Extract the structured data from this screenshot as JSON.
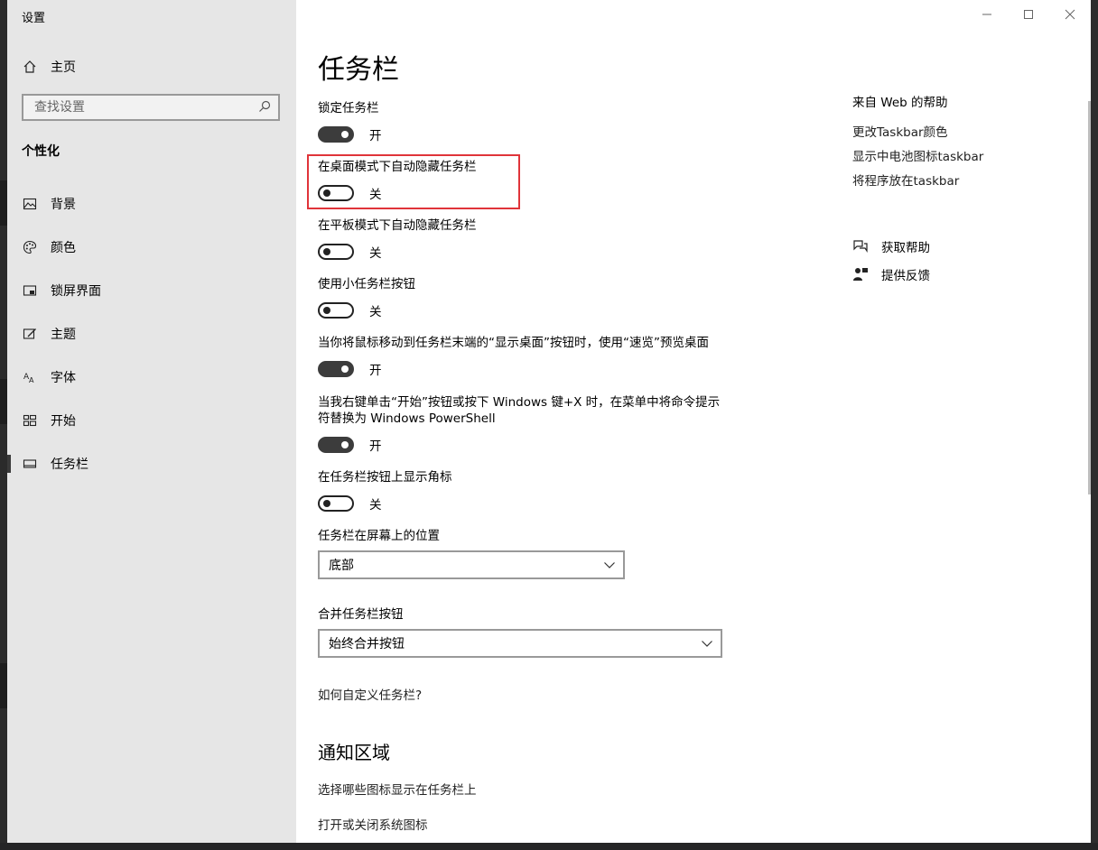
{
  "app": {
    "title": "设置"
  },
  "sidebar": {
    "home_label": "主页",
    "search_placeholder": "查找设置",
    "section_label": "个性化",
    "items": [
      {
        "label": "背景",
        "icon": "image-icon"
      },
      {
        "label": "颜色",
        "icon": "palette-icon"
      },
      {
        "label": "锁屏界面",
        "icon": "lock-screen-icon"
      },
      {
        "label": "主题",
        "icon": "theme-icon"
      },
      {
        "label": "字体",
        "icon": "font-icon"
      },
      {
        "label": "开始",
        "icon": "start-icon"
      },
      {
        "label": "任务栏",
        "icon": "taskbar-icon",
        "active": true
      }
    ]
  },
  "main": {
    "title": "任务栏",
    "settings": [
      {
        "label": "锁定任务栏",
        "state": "on",
        "state_label": "开"
      },
      {
        "label": "在桌面模式下自动隐藏任务栏",
        "state": "off",
        "state_label": "关",
        "highlighted": true
      },
      {
        "label": "在平板模式下自动隐藏任务栏",
        "state": "off",
        "state_label": "关"
      },
      {
        "label": "使用小任务栏按钮",
        "state": "off",
        "state_label": "关"
      },
      {
        "label": "当你将鼠标移动到任务栏末端的“显示桌面”按钮时，使用“速览”预览桌面",
        "state": "on",
        "state_label": "开"
      },
      {
        "label": "当我右键单击“开始”按钮或按下 Windows 键+X 时，在菜单中将命令提示符替换为 Windows PowerShell",
        "state": "on",
        "state_label": "开"
      },
      {
        "label": "在任务栏按钮上显示角标",
        "state": "off",
        "state_label": "关"
      }
    ],
    "position": {
      "label": "任务栏在屏幕上的位置",
      "value": "底部"
    },
    "combine": {
      "label": "合并任务栏按钮",
      "value": "始终合并按钮"
    },
    "customize_link": "如何自定义任务栏?",
    "notification": {
      "title": "通知区域",
      "link1": "选择哪些图标显示在任务栏上",
      "link2": "打开或关闭系统图标"
    }
  },
  "help": {
    "title": "来自 Web 的帮助",
    "links": [
      "更改Taskbar颜色",
      "显示中电池图标taskbar",
      "将程序放在taskbar"
    ],
    "get_help": "获取帮助",
    "feedback": "提供反馈"
  },
  "colors": {
    "highlight": "#e0343a",
    "toggle_on": "#3c3c3c",
    "sidebar_bg": "#e6e6e6"
  }
}
